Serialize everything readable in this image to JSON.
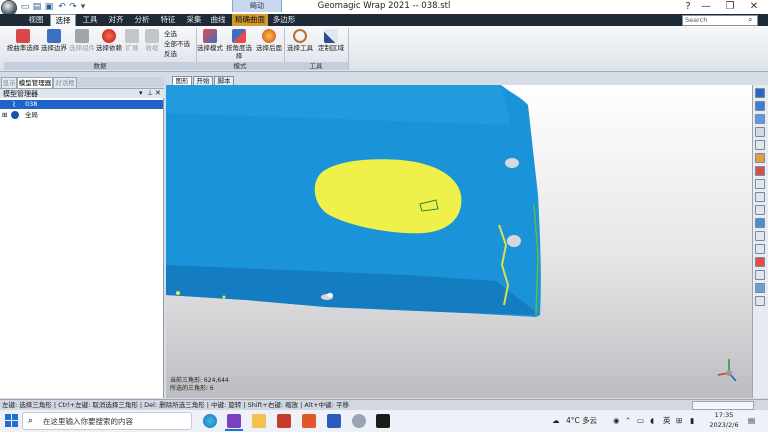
{
  "window": {
    "title": "Geomagic Wrap 2021 -- 038.stl",
    "context_group": "畸动"
  },
  "ribbon": {
    "tabs": [
      {
        "label": "视图"
      },
      {
        "label": "选择"
      },
      {
        "label": "工具"
      },
      {
        "label": "对齐"
      },
      {
        "label": "分析"
      },
      {
        "label": "特征"
      },
      {
        "label": "采集"
      },
      {
        "label": "曲线"
      },
      {
        "label": "精确曲面"
      },
      {
        "label": "多边形"
      }
    ],
    "search_placeholder": "Search",
    "groups": {
      "data": {
        "caption": "数据",
        "buttons": [
          "按曲率选择",
          "选择边界",
          "选择组件",
          "选择依赖",
          "扩展",
          "收缩"
        ],
        "small": [
          "全选",
          "全部不选",
          "反选"
        ]
      },
      "mode": {
        "caption": "模式",
        "buttons": [
          "选择模式",
          "按角度选择",
          "选择后面"
        ]
      },
      "tools": {
        "caption": "工具",
        "buttons": [
          "选择工具",
          "定制区域"
        ]
      }
    }
  },
  "panel": {
    "tabs": [
      "显示",
      "模型管理器",
      "对话框"
    ],
    "header": "模型管理器",
    "tree": [
      {
        "label": "038",
        "selected": true
      },
      {
        "label": "全局",
        "selected": false
      }
    ]
  },
  "viewport": {
    "tabs": [
      "图形",
      "开始",
      "脚本"
    ],
    "status_lines": [
      "当前三角形: 624,644",
      "所选的三角形: 6"
    ]
  },
  "statusbar": {
    "hint": "左键: 选择三角形 | Ctrl+左键: 取消选择三角形 | Del: 删除所选三角形 | 中键: 旋转 | Shift+右键: 缩放 | Alt+中键: 平移"
  },
  "taskbar": {
    "search_placeholder": "在这里输入你要搜索的内容",
    "weather": "4°C 多云",
    "ime": "英",
    "time": "17:35",
    "date": "2023/2/6"
  },
  "colors": {
    "mesh": "#1a93d8",
    "selection": "#f0f04a",
    "ribbon_dark": "#1f2a37",
    "context_tab": "#d59a2e"
  }
}
